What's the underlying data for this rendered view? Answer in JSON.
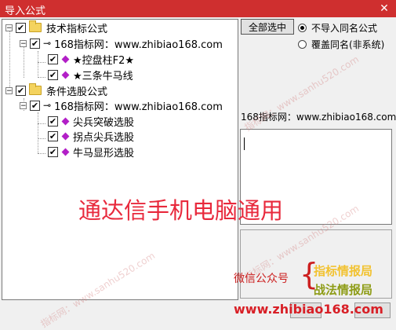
{
  "window": {
    "title": "导入公式"
  },
  "tree": {
    "root1": {
      "label": "技术指标公式",
      "site": "168指标网：www.zhibiao168.com",
      "items": [
        "★控盘柱F2★",
        "★三条牛马线"
      ]
    },
    "root2": {
      "label": "条件选股公式",
      "site": "168指标网：www.zhibiao168.com",
      "items": [
        "尖兵突破选股",
        "拐点尖兵选股",
        "牛马显形选股"
      ]
    }
  },
  "right": {
    "select_all": "全部选中",
    "radio1": "不导入同名公式",
    "radio2": "覆盖同名(非系统)",
    "site_label": "168指标网：www.zhibiao168.com"
  },
  "overlay": {
    "headline": "通达信手机电脑通用",
    "wechat_label": "微信公众号",
    "brand1": "指标情报局",
    "brand2": "战法情报局",
    "url": "www.zhibiao168.com"
  },
  "watermark": "指标网：www.sanhu520.com"
}
